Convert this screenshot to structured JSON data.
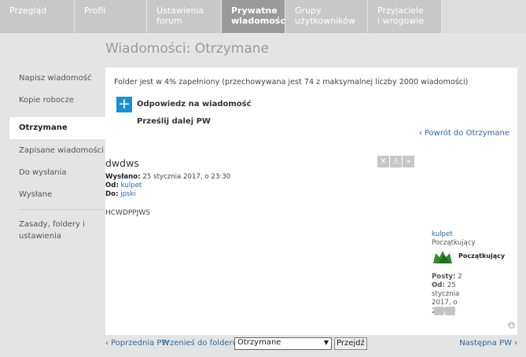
{
  "tabs": [
    {
      "label": "Przegląd"
    },
    {
      "label": "Profil"
    },
    {
      "label": "Ustawienia forum"
    },
    {
      "label": "Prywatne wiadomości"
    },
    {
      "label": "Grupy użytkowników"
    },
    {
      "label": "Przyjaciele i wrogowie"
    }
  ],
  "page_title": "Wiadomości: Otrzymane",
  "sidebar": {
    "items": [
      {
        "label": "Napisz wiadomość"
      },
      {
        "label": "Kopie robocze"
      },
      {
        "label": "Otrzymane"
      },
      {
        "label": "Zapisane wiadomości"
      },
      {
        "label": "Do wysłania"
      },
      {
        "label": "Wysłane"
      },
      {
        "label": "Zasady, foldery i ustawienia"
      }
    ]
  },
  "folder_info": "Folder jest w 4% zapełniony (przechowywana jest 74 z maksymalnej liczby 2000 wiadomości)",
  "actions": {
    "reply_icon": "plus-icon",
    "reply": "Odpowiedz na wiadomość",
    "forward": "Prześlij dalej PW",
    "back": "Powrót do Otrzymane"
  },
  "message": {
    "subject": "dwdws",
    "sent_label": "Wysłano:",
    "sent": "25 stycznia 2017, o 23:30",
    "from_label": "Od:",
    "from": "kulpet",
    "to_label": "Do:",
    "to": "jpski",
    "body": "HCWDPPJWS",
    "action_icons": [
      "close-icon",
      "warning-icon",
      "forward-icon"
    ]
  },
  "author": {
    "name": "kulpet",
    "rank": "Początkujący",
    "rank_badge": "Początkujący",
    "posts_label": "Posty:",
    "posts": "2",
    "joined_label": "Od:",
    "joined": "25 stycznia 2017, o 22:45"
  },
  "bottom": {
    "prev": "Poprzednia PW",
    "move_label": "Przenieś do folderu:",
    "folder_selected": "Otrzymane",
    "go": "Przejdź",
    "next": "Następna PW"
  },
  "colors": {
    "accent": "#1d8fd1",
    "link": "#2a6aa0",
    "active_tab": "#9a9a9a",
    "rank_green": "#2e8b2e"
  }
}
